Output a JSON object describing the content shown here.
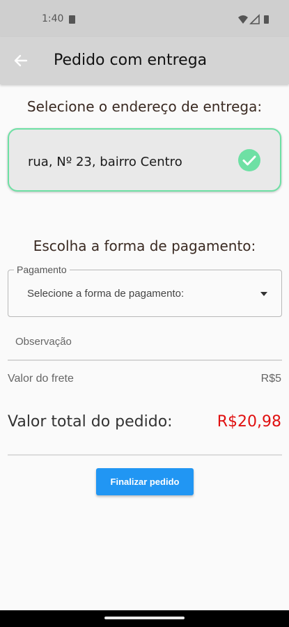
{
  "status_bar": {
    "time": "1:40"
  },
  "app_bar": {
    "title": "Pedido com entrega"
  },
  "address": {
    "heading": "Selecione o endereço de entrega:",
    "selected_address": "rua, Nº 23, bairro Centro"
  },
  "payment": {
    "heading": "Escolha a forma de pagamento:",
    "field_label": "Pagamento",
    "placeholder": "Selecione a forma de pagamento:"
  },
  "observation": {
    "label": "Observação"
  },
  "summary": {
    "freight_label": "Valor do frete",
    "freight_value": "R$5",
    "total_label": "Valor total do pedido:",
    "total_value": "R$20,98"
  },
  "actions": {
    "finish_label": "Finalizar pedido"
  },
  "colors": {
    "accent": "#2196f3",
    "selected_border": "#6ee0a4",
    "total_price": "#e01010"
  },
  "icons": [
    "back-arrow-icon",
    "check-circle-icon",
    "dropdown-arrow-icon",
    "wifi-icon",
    "signal-icon",
    "battery-icon"
  ]
}
